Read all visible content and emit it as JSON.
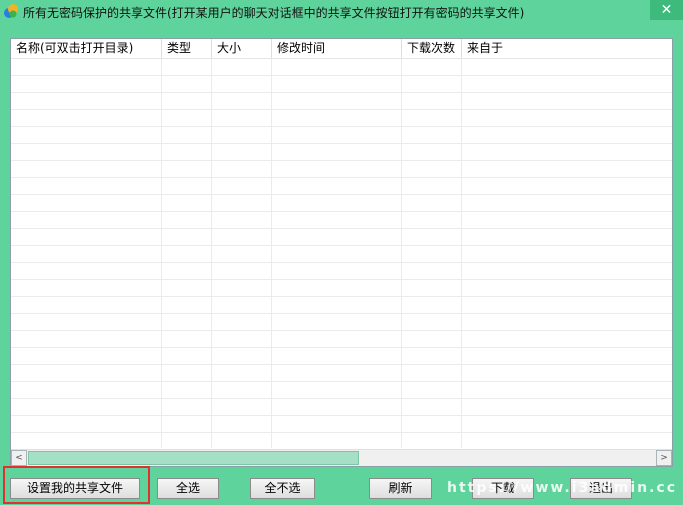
{
  "window": {
    "title": "所有无密码保护的共享文件(打开某用户的聊天对话框中的共享文件按钮打开有密码的共享文件)",
    "close_glyph": "✕",
    "icon": "app-icon"
  },
  "table": {
    "columns": [
      "名称(可双击打开目录)",
      "类型",
      "大小",
      "修改时间",
      "下载次数",
      "来自于"
    ],
    "rows": []
  },
  "scrollbar": {
    "left_arrow": "<",
    "right_arrow": ">"
  },
  "buttons": {
    "set_share": "设置我的共享文件",
    "select_all": "全选",
    "select_none": "全不选",
    "refresh": "刷新",
    "download": "下载",
    "exit": "退出"
  },
  "watermark": "https://www.i3admin.cc",
  "colors": {
    "window_bg": "#5ed49c",
    "highlight_border": "#e03030"
  }
}
